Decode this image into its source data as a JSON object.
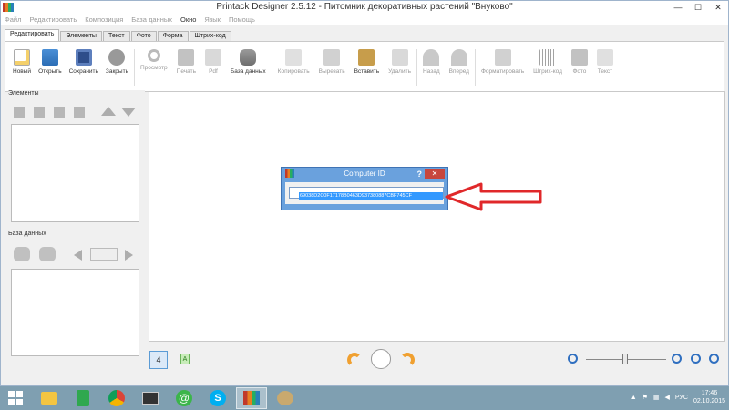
{
  "window": {
    "title": "Printack Designer 2.5.12 - Питомник декоративных растений \"Внуково\"",
    "controls": {
      "minimize": "—",
      "maximize": "☐",
      "close": "✕"
    }
  },
  "menu": [
    "Файл",
    "Редактировать",
    "Композиция",
    "База данных",
    "Окно",
    "Язык",
    "Помощь"
  ],
  "tabs": [
    "Редактировать",
    "Элементы",
    "Текст",
    "Фото",
    "Форма",
    "Штрих-код"
  ],
  "toolbar": {
    "new": "Новый",
    "open": "Открыть",
    "save": "Сохранить",
    "close": "Закрыть",
    "preview": "Просмотр",
    "print": "Печать",
    "pdf": "Pdf",
    "database": "База данных",
    "copy": "Копировать",
    "cut": "Вырезать",
    "paste": "Вставить",
    "delete": "Удалить",
    "back": "Назад",
    "forward": "Вперед",
    "format": "Форматировать",
    "barcode": "Штрих-код",
    "photo": "Фото",
    "text": "Текст"
  },
  "panels": {
    "elements": "Элементы",
    "database": "База данных"
  },
  "dialog": {
    "title": "Computer ID",
    "help": "?",
    "close": "✕",
    "computer_id": "69038D2C0F17178B0463D937380887CBF745CF"
  },
  "bottom": {
    "page_number": "4",
    "page_tag": "A"
  },
  "taskbar": {
    "language": "РУС",
    "time": "17:46",
    "date": "02.10.2015"
  },
  "colors": {
    "accent": "#3399ff",
    "arrow": "#e0282a",
    "taskbar": "#7f9fb1"
  }
}
